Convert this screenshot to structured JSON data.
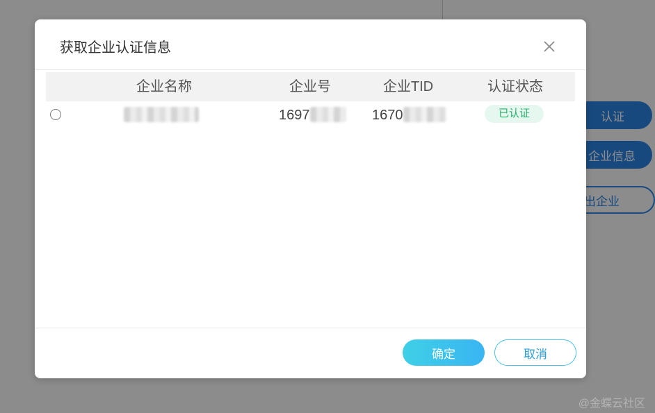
{
  "background": {
    "buttons": [
      {
        "label": "认证"
      },
      {
        "label": "企业信息"
      },
      {
        "label": "出企业"
      }
    ],
    "watermark": "@金蝶云社区"
  },
  "dialog": {
    "title": "获取企业认证信息",
    "close_icon": "close-icon",
    "table": {
      "columns": [
        "企业名称",
        "企业号",
        "企业TID",
        "认证状态"
      ],
      "rows": [
        {
          "selected": false,
          "name": "",
          "number": "1697",
          "tid": "1670",
          "status": "已认证"
        }
      ]
    },
    "confirm_label": "确定",
    "cancel_label": "取消"
  },
  "colors": {
    "accent": "#2b86e8",
    "confirm_gradient_start": "#3fd0e6",
    "confirm_gradient_end": "#39b5f2",
    "status_text": "#27b06a",
    "status_bg": "#e5f7ee"
  }
}
